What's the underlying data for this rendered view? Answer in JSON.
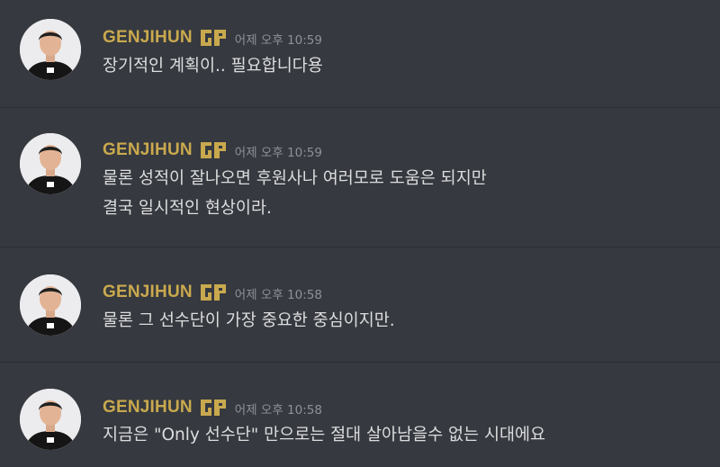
{
  "colors": {
    "background": "#36393f",
    "divider": "#2b2d31",
    "username": "#c9a94e",
    "timestamp": "#8e9297",
    "message_text": "#dcddde"
  },
  "badge_icon": "geng-logo-icon",
  "messages": [
    {
      "username": "GENJIHUN",
      "timestamp": "어제 오후 10:59",
      "lines": [
        "장기적인 계획이.. 필요합니다용"
      ]
    },
    {
      "username": "GENJIHUN",
      "timestamp": "어제 오후 10:59",
      "lines": [
        "물론 성적이 잘나오면 후원사나 여러모로 도움은 되지만",
        "결국 일시적인 현상이라."
      ]
    },
    {
      "username": "GENJIHUN",
      "timestamp": "어제 오후 10:58",
      "lines": [
        "물론 그 선수단이 가장 중요한 중심이지만."
      ]
    },
    {
      "username": "GENJIHUN",
      "timestamp": "어제 오후 10:58",
      "lines": [
        "지금은 \"Only 선수단\" 만으로는 절대 살아남을수 없는 시대에요"
      ]
    }
  ]
}
